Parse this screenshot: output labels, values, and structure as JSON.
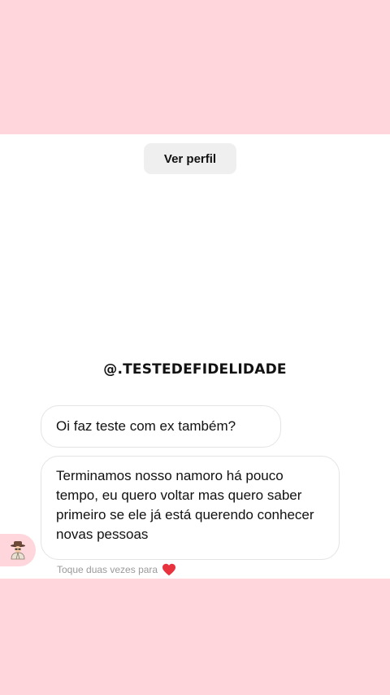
{
  "header": {
    "view_profile_label": "Ver perfil"
  },
  "watermark": "@.TESTEDEFIDELIDADE",
  "messages": [
    {
      "text": "Oi faz teste com ex também?"
    },
    {
      "text": "Terminamos nosso namoro há pouco tempo, eu quero voltar mas quero saber primeiro se ele já está querendo conhecer novas pessoas"
    }
  ],
  "hint": {
    "text": "Toque duas vezes para",
    "icon": "heart-icon",
    "icon_color": "#e8323e"
  },
  "colors": {
    "background_pink": "#ffd6dc",
    "panel_white": "#ffffff",
    "button_gray": "#efefef"
  }
}
